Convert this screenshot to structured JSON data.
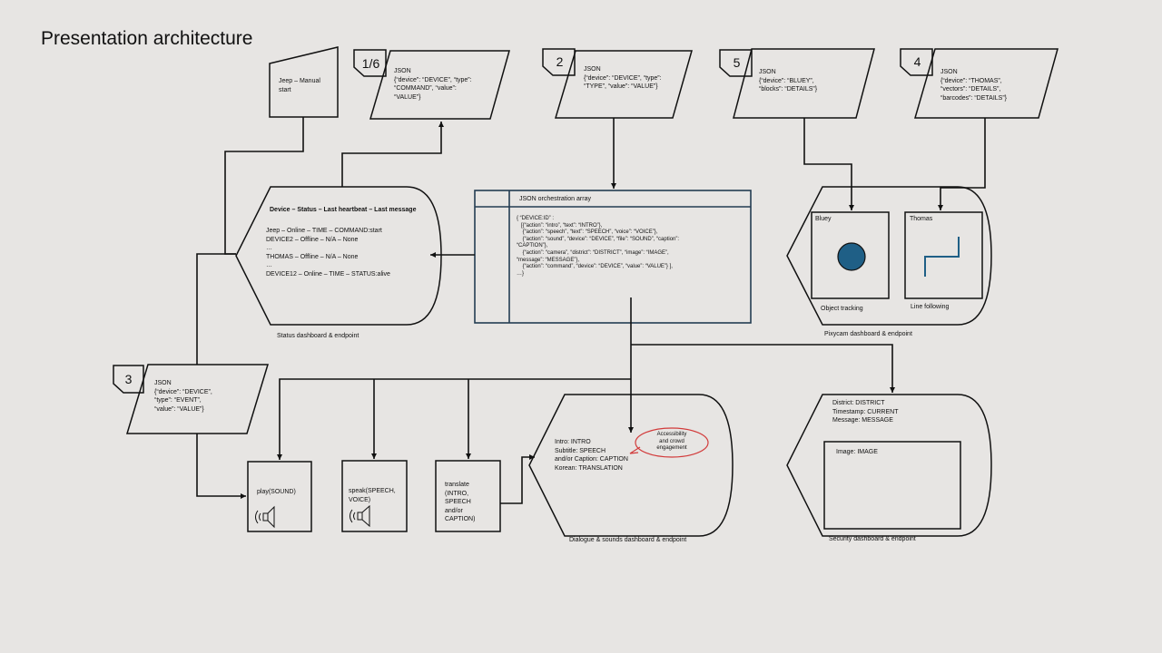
{
  "title": "Presentation architecture",
  "badges": {
    "b16": "1/6",
    "b2": "2",
    "b5": "5",
    "b4": "4",
    "b3": "3"
  },
  "manual": {
    "text": "Jeep – Manual\nstart"
  },
  "json_boxes": {
    "command": "JSON\n{“device”: “DEVICE”, “type”:\n“COMMAND”, “value”:\n“VALUE”}",
    "type": "JSON\n{“device”: “DEVICE”, “type”:\n“TYPE”, “value”: “VALUE”}",
    "bluey": "JSON\n{“device”: “BLUEY”,\n“blocks”: “DETAILS”}",
    "thomas": "JSON\n{“device”: “THOMAS”,\n“vectors”: “DETAILS”,\n“barcodes”: “DETAILS”}",
    "event": "JSON\n{“device”: “DEVICE”,\n“type”: “EVENT”,\n“value”: “VALUE”}"
  },
  "status": {
    "header": "Device – Status – Last heartbeat – Last message",
    "body": "Jeep – Online – TIME – COMMAND:start\nDEVICE2 – Offline – N/A – None\n…\nTHOMAS – Offline – N/A – None\n…\nDEVICE12 – Online – TIME – STATUS:alive",
    "caption": "Status dashboard & endpoint"
  },
  "orchestration": {
    "header": "JSON orchestration array",
    "body": "{ “DEVICE:ID” :\n   [{“action”: “intro”, “text”: “INTRO”},\n    {“action”: “speech”, “text”: “SPEECH”, “voice”: “VOICE”},\n    {“action”: “sound”, “device”: “DEVICE”, “file”: “SOUND”, “caption”:\n“CAPTION”},\n    {“action”: “camera”, “district”: “DISTRICT”, “image”: “IMAGE”,\n“message”: “MESSAGE”},\n    {“action”: “command”, “device”: “DEVICE”, “value”: “VALUE”} ],\n…}"
  },
  "pixycam": {
    "bluey_label": "Bluey",
    "thomas_label": "Thomas",
    "object_caption": "Object tracking",
    "line_caption": "Line following",
    "caption": "Pixycam dashboard & endpoint"
  },
  "functions": {
    "play": "play(SOUND)",
    "speak": "speak(SPEECH,\nVOICE)",
    "translate": "translate\n(INTRO,\nSPEECH\nand/or\nCAPTION)"
  },
  "dialogue": {
    "body": "Intro: INTRO\nSubtitle: SPEECH\nand/or Caption: CAPTION\nKorean: TRANSLATION",
    "callout": "Accessibility\nand crowd\nengagement",
    "caption": "Dialogue & sounds dashboard & endpoint"
  },
  "security": {
    "body": "District: DISTRICT\nTimestamp: CURRENT\nMessage: MESSAGE",
    "image_label": "Image: IMAGE",
    "caption": "Security dashboard & endpoint"
  },
  "colors": {
    "circle": "#1f5f86",
    "line": "#1f5f86",
    "table_border": "#243c52",
    "callout": "#d23b3b",
    "background": "#e7e5e3"
  }
}
